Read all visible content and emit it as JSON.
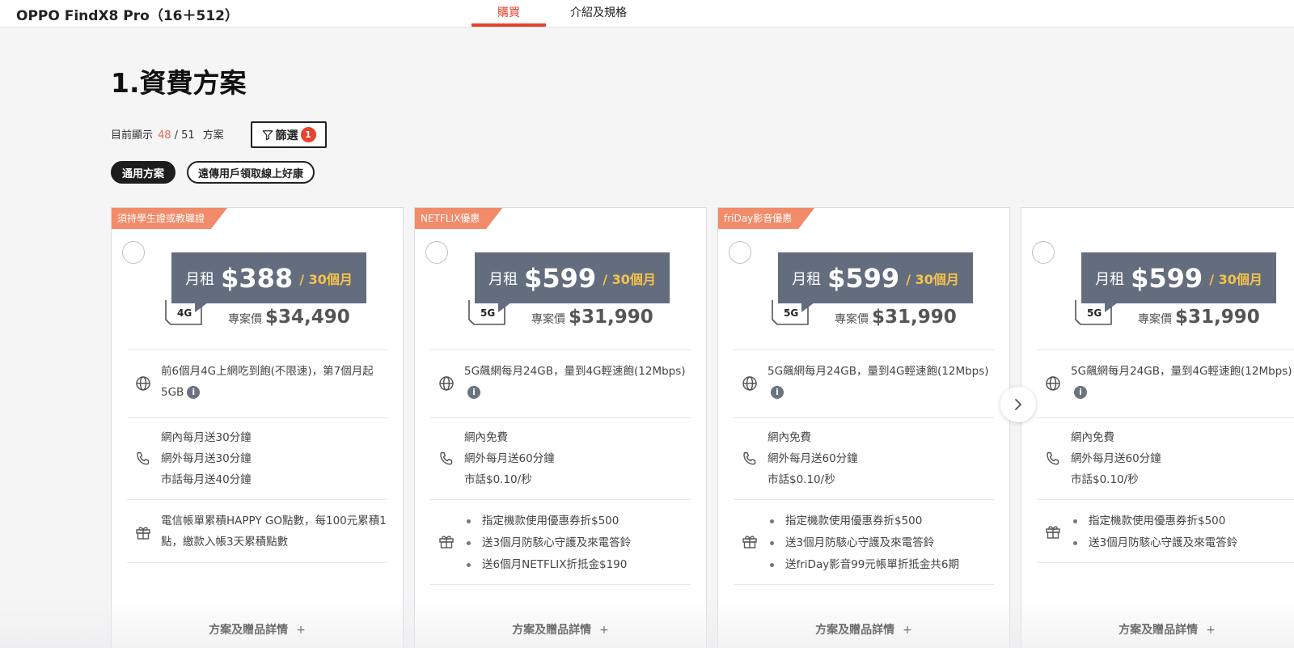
{
  "header": {
    "product_name": "OPPO FindX8 Pro（16＋512）",
    "tabs": [
      {
        "label": "購買",
        "active": true
      },
      {
        "label": "介紹及規格",
        "active": false
      }
    ],
    "accent_color": "#e8412e"
  },
  "section": {
    "title": "1.資費方案",
    "showing_prefix": "目前顯示",
    "showing_count": "48",
    "showing_total": "/ 51",
    "showing_suffix": "方案",
    "filter_label": "篩選",
    "filter_badge": "1"
  },
  "chips": [
    {
      "label": "通用方案",
      "active": true
    },
    {
      "label": "遠傳用戶領取線上好康",
      "active": false
    }
  ],
  "cards": [
    {
      "ribbon": "須持學生證或教職證",
      "price_label": "月租",
      "price": "$388",
      "term": "/ 30個月",
      "network": "4G",
      "special_label": "專案價",
      "special_price": "$34,490",
      "data_text": "前6個月4G上網吃到飽(不限速)，第7個月起5GB",
      "voice": [
        "網內每月送30分鐘",
        "網外每月送30分鐘",
        "市話每月送40分鐘"
      ],
      "gift_text": "電信帳單累積HAPPY GO點數，每100元累積1點，繳款入帳3天累積點數",
      "gift_bullets": [],
      "details": "方案及贈品詳情"
    },
    {
      "ribbon": "NETFLIX優惠",
      "price_label": "月租",
      "price": "$599",
      "term": "/ 30個月",
      "network": "5G",
      "special_label": "專案價",
      "special_price": "$31,990",
      "data_text": "5G飆網每月24GB，量到4G輕速飽(12Mbps)",
      "voice": [
        "網內免費",
        "網外每月送60分鐘",
        "市話$0.10/秒"
      ],
      "gift_text": "",
      "gift_bullets": [
        "指定機款使用優惠券折$500",
        "送3個月防駭心守護及來電答鈴",
        "送6個月NETFLIX折抵金$190"
      ],
      "details": "方案及贈品詳情"
    },
    {
      "ribbon": "friDay影音優惠",
      "price_label": "月租",
      "price": "$599",
      "term": "/ 30個月",
      "network": "5G",
      "special_label": "專案價",
      "special_price": "$31,990",
      "data_text": "5G飆網每月24GB，量到4G輕速飽(12Mbps)",
      "voice": [
        "網內免費",
        "網外每月送60分鐘",
        "市話$0.10/秒"
      ],
      "gift_text": "",
      "gift_bullets": [
        "指定機款使用優惠券折$500",
        "送3個月防駭心守護及來電答鈴",
        "送friDay影音99元帳單折抵金共6期"
      ],
      "details": "方案及贈品詳情"
    },
    {
      "ribbon": "",
      "price_label": "月租",
      "price": "$599",
      "term": "/ 30個月",
      "network": "5G",
      "special_label": "專案價",
      "special_price": "$31,990",
      "data_text": "5G飆網每月24GB，量到4G輕速飽(12Mbps)",
      "voice": [
        "網內免費",
        "網外每月送60分鐘",
        "市話$0.10/秒"
      ],
      "gift_text": "",
      "gift_bullets": [
        "指定機款使用優惠券折$500",
        "送3個月防駭心守護及來電答鈴"
      ],
      "details": "方案及贈品詳情"
    }
  ],
  "icons": {
    "data": "globe-icon",
    "voice": "phone-icon",
    "gift": "gift-icon",
    "next": "chevron-right-icon",
    "filter": "funnel-icon"
  }
}
